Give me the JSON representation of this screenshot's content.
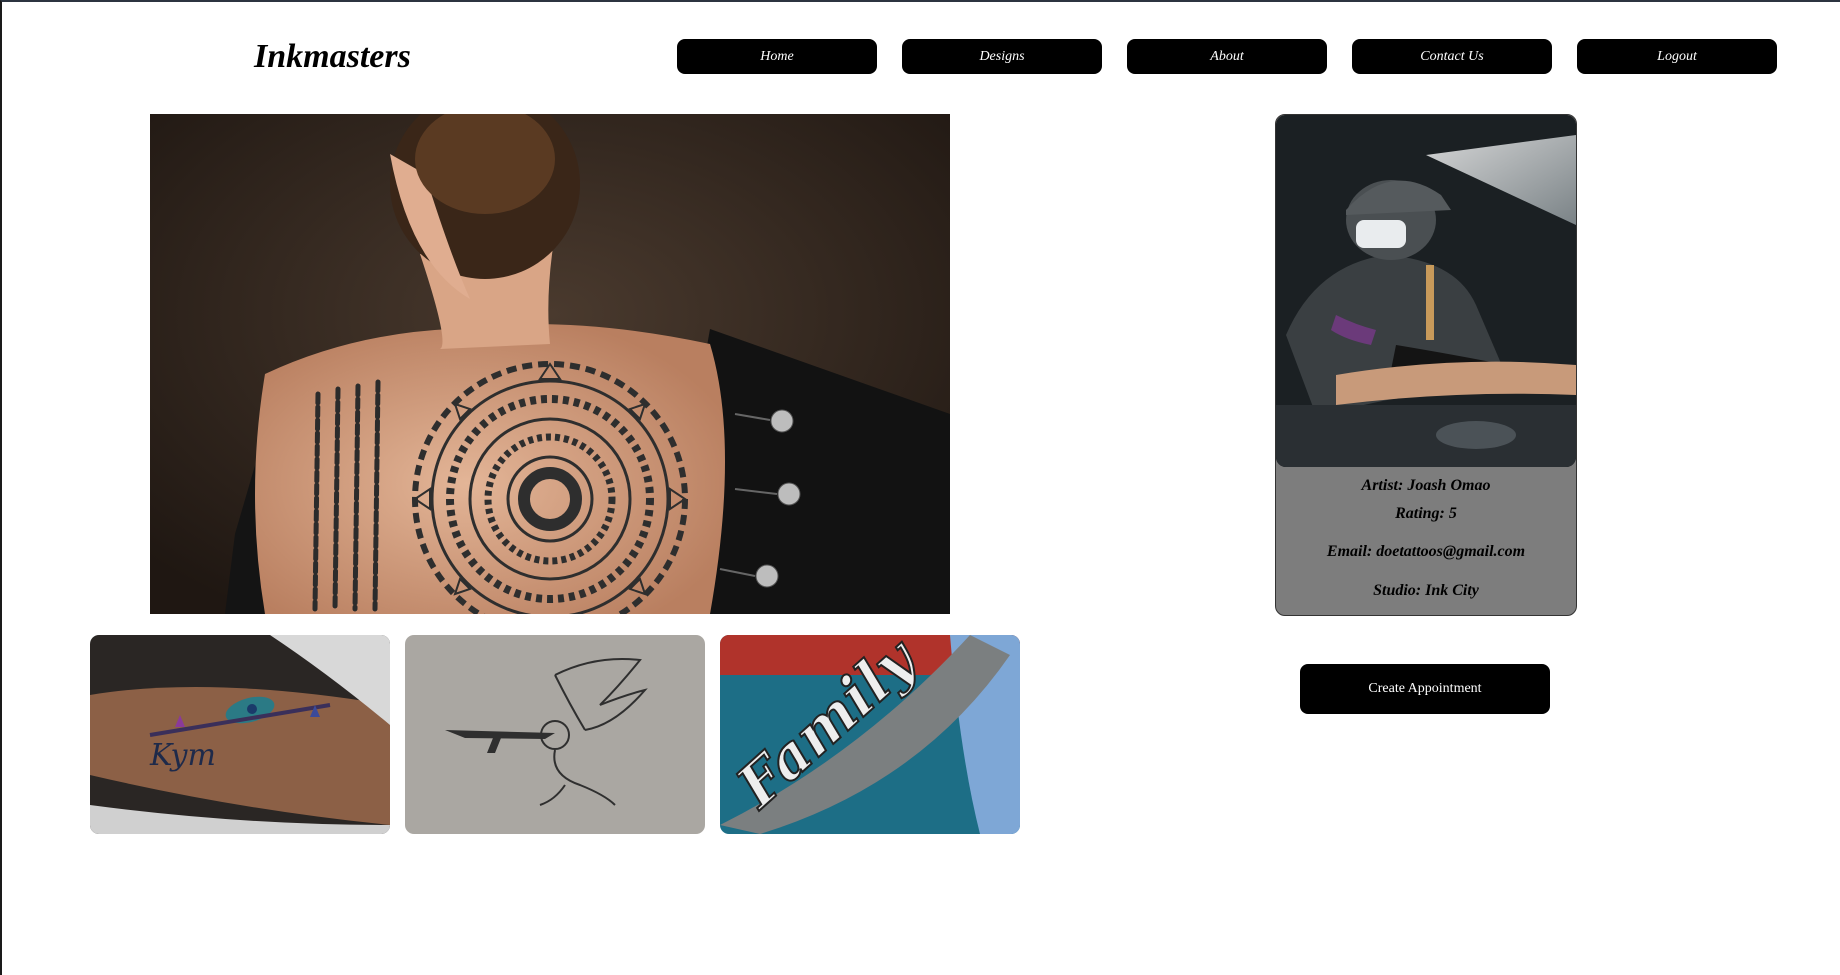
{
  "brand": {
    "name": "Inkmasters"
  },
  "nav": {
    "items": [
      {
        "label": "Home"
      },
      {
        "label": "Designs"
      },
      {
        "label": "About"
      },
      {
        "label": "Contact Us"
      },
      {
        "label": "Logout"
      }
    ]
  },
  "hero": {
    "subject": "back-mandala-tattoo"
  },
  "gallery": {
    "items": [
      {
        "subject": "feather-name-tattoo",
        "script": "Kym"
      },
      {
        "subject": "cherub-rifle-sketch"
      },
      {
        "subject": "family-forearm-tattoo",
        "script": "Family"
      }
    ]
  },
  "artist": {
    "name_line": "Artist: Joash Omao",
    "rating_line": "Rating: 5",
    "email_line": "Email: doetattoos@gmail.com",
    "studio_line": "Studio: Ink City"
  },
  "actions": {
    "create_appointment": "Create Appointment"
  },
  "colors": {
    "button_bg": "#000000",
    "button_text": "#ffffff",
    "card_bg": "#7d7d7d",
    "page_bg": "#ffffff"
  }
}
